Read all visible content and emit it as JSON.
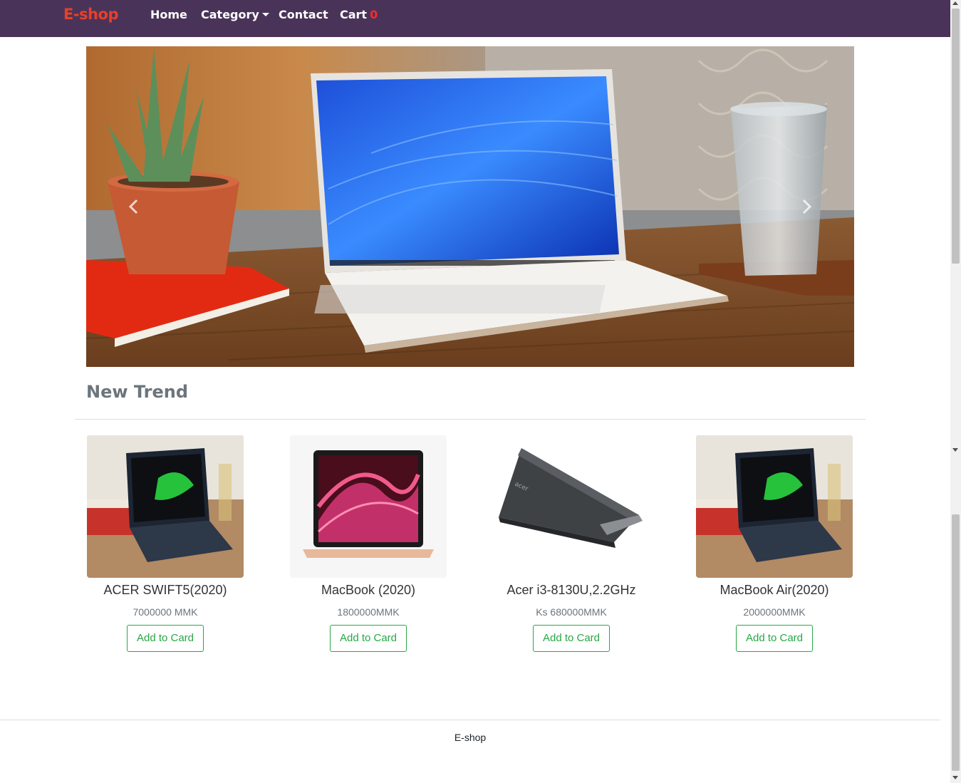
{
  "navbar": {
    "brand": "E-shop",
    "items": [
      {
        "label": "Home"
      },
      {
        "label": "Category"
      },
      {
        "label": "Contact"
      },
      {
        "label": "Cart"
      }
    ],
    "cart_count": "0",
    "bg_color": "#4a3358",
    "brand_color": "#e8402a"
  },
  "carousel": {
    "prev_icon": "chevron-left-icon",
    "next_icon": "chevron-right-icon"
  },
  "section": {
    "title": "New Trend"
  },
  "products": [
    {
      "name": "ACER SWIFT5(2020)",
      "price": "7000000 MMK",
      "button": "Add to Card"
    },
    {
      "name": "MacBook (2020)",
      "price": "1800000MMK",
      "button": "Add to Card"
    },
    {
      "name": "Acer i3-8130U,2.2GHz",
      "price": "Ks 680000MMK",
      "button": "Add to Card"
    },
    {
      "name": "MacBook Air(2020)",
      "price": "2000000MMK",
      "button": "Add to Card"
    }
  ],
  "footer": {
    "text": "E-shop"
  },
  "colors": {
    "button_accent": "#28a745",
    "heading_gray": "#6c757d",
    "cart_count": "#ff2a2a"
  }
}
